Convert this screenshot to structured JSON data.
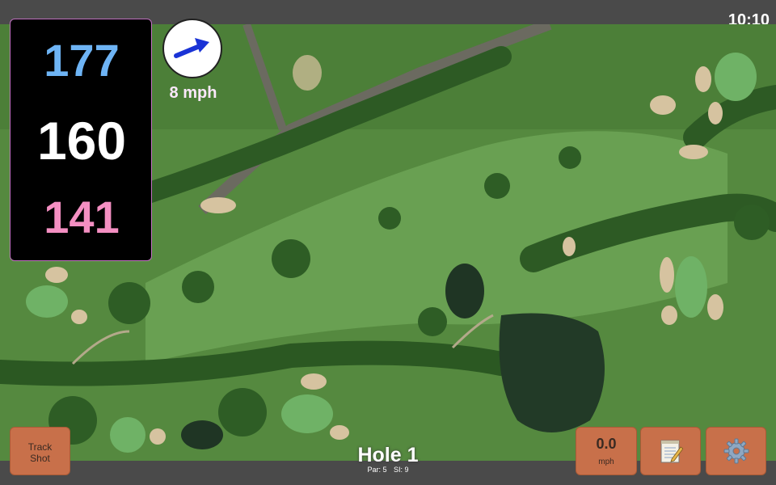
{
  "status": {
    "time": "10:10"
  },
  "distances": {
    "back": "177",
    "middle": "160",
    "front": "141"
  },
  "wind": {
    "speed_label": "8 mph",
    "icon": "wind-direction-arrow-icon"
  },
  "hole": {
    "title": "Hole 1",
    "par": "Par: 5",
    "si": "SI: 9"
  },
  "buttons": {
    "track_shot": {
      "line1": "Track",
      "line2": "Shot"
    },
    "speed": {
      "value": "0.0",
      "unit": "mph"
    },
    "notes": {
      "icon": "notepad-icon"
    },
    "settings": {
      "icon": "gear-icon"
    }
  },
  "colors": {
    "back_distance": "#6eb4f5",
    "middle_distance": "#ffffff",
    "front_distance": "#f48fc2",
    "button": "#c8704a",
    "panel_border": "#c070c0"
  }
}
